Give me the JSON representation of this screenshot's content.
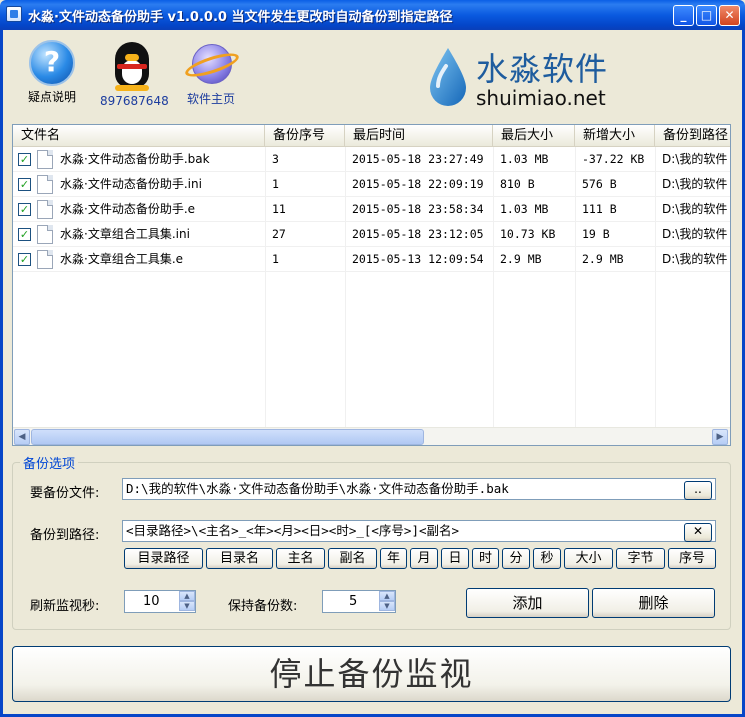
{
  "window": {
    "title": "水淼·文件动态备份助手 v1.0.0.0     当文件发生更改时自动备份到指定路径",
    "buttons": {
      "minimize": "_",
      "maximize": "□",
      "close": "✕"
    }
  },
  "toolbar": {
    "help_label": "疑点说明",
    "qq_label": "897687648",
    "home_label": "软件主页"
  },
  "brand": {
    "name": "水淼软件",
    "url": "shuimiao.net"
  },
  "table": {
    "columns": [
      "文件名",
      "备份序号",
      "最后时间",
      "最后大小",
      "新增大小",
      "备份到路径"
    ],
    "rows": [
      {
        "checked": "✓",
        "name": "水淼·文件动态备份助手.bak",
        "seq": "3",
        "time": "2015-05-18 23:27:49",
        "last_size": "1.03 MB",
        "added_size": "-37.22 KB",
        "path": "D:\\我的软件"
      },
      {
        "checked": "✓",
        "name": "水淼·文件动态备份助手.ini",
        "seq": "1",
        "time": "2015-05-18 22:09:19",
        "last_size": "810 B",
        "added_size": "576 B",
        "path": "D:\\我的软件"
      },
      {
        "checked": "✓",
        "name": "水淼·文件动态备份助手.e",
        "seq": "11",
        "time": "2015-05-18 23:58:34",
        "last_size": "1.03 MB",
        "added_size": "111 B",
        "path": "D:\\我的软件"
      },
      {
        "checked": "✓",
        "name": "水淼·文章组合工具集.ini",
        "seq": "27",
        "time": "2015-05-18 23:12:05",
        "last_size": "10.73 KB",
        "added_size": "19 B",
        "path": "D:\\我的软件"
      },
      {
        "checked": "✓",
        "name": "水淼·文章组合工具集.e",
        "seq": "1",
        "time": "2015-05-13 12:09:54",
        "last_size": "2.9 MB",
        "added_size": "2.9 MB",
        "path": "D:\\我的软件"
      }
    ],
    "scroll_left": "◀",
    "scroll_right": "▶"
  },
  "options": {
    "group_title": "备份选项",
    "source_label": "要备份文件:",
    "source_value": "D:\\我的软件\\水淼·文件动态备份助手\\水淼·文件动态备份助手.bak",
    "browse_label": "..",
    "dest_label": "备份到路径:",
    "dest_value": "<目录路径>\\<主名>_<年><月><日><时>_[<序号>]<副名>",
    "clear_label": "✕",
    "tokens": [
      "目录路径",
      "目录名",
      "主名",
      "副名",
      "年",
      "月",
      "日",
      "时",
      "分",
      "秒",
      "大小",
      "字节",
      "序号"
    ],
    "refresh_label": "刷新监视秒:",
    "refresh_value": "10",
    "keep_label": "保持备份数:",
    "keep_value": "5",
    "spin_up": "▲",
    "spin_down": "▼",
    "add_label": "添加",
    "delete_label": "删除"
  },
  "stop_label": "停止备份监视"
}
